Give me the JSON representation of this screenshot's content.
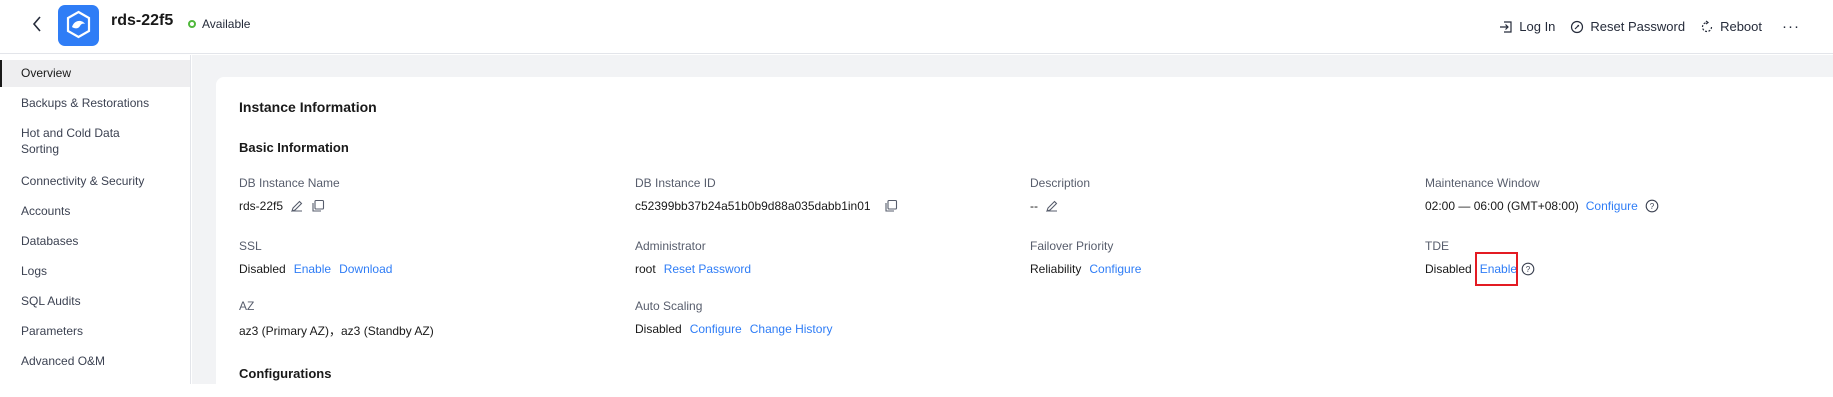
{
  "header": {
    "instance_name": "rds-22f5",
    "status": "Available",
    "actions": {
      "log_in": "Log In",
      "reset_password": "Reset Password",
      "reboot": "Reboot",
      "more": "···"
    }
  },
  "sidebar": {
    "items": [
      {
        "label": "Overview",
        "active": true
      },
      {
        "label": "Backups & Restorations"
      },
      {
        "label": "Hot and Cold Data Sorting"
      },
      {
        "label": "Connectivity & Security"
      },
      {
        "label": "Accounts"
      },
      {
        "label": "Databases"
      },
      {
        "label": "Logs"
      },
      {
        "label": "SQL Audits"
      },
      {
        "label": "Parameters"
      },
      {
        "label": "Advanced O&M"
      }
    ]
  },
  "content": {
    "section_title": "Instance Information",
    "basic_info_title": "Basic Information",
    "configurations_title": "Configurations",
    "fields": {
      "db_instance_name": {
        "label": "DB Instance Name",
        "value": "rds-22f5"
      },
      "db_instance_id": {
        "label": "DB Instance ID",
        "value": "c52399bb37b24a51b0b9d88a035dabb1in01"
      },
      "description": {
        "label": "Description",
        "value": "--"
      },
      "maintenance_window": {
        "label": "Maintenance Window",
        "value": "02:00 — 06:00 (GMT+08:00)",
        "action": "Configure"
      },
      "ssl": {
        "label": "SSL",
        "value": "Disabled",
        "action1": "Enable",
        "action2": "Download"
      },
      "administrator": {
        "label": "Administrator",
        "value": "root",
        "action": "Reset Password"
      },
      "failover_priority": {
        "label": "Failover Priority",
        "value": "Reliability",
        "action": "Configure"
      },
      "tde": {
        "label": "TDE",
        "value": "Disabled",
        "action": "Enable"
      },
      "az": {
        "label": "AZ",
        "value": "az3 (Primary AZ)，az3 (Standby AZ)"
      },
      "auto_scaling": {
        "label": "Auto Scaling",
        "value": "Disabled",
        "action1": "Configure",
        "action2": "Change History"
      }
    }
  },
  "colors": {
    "accent": "#2f7df6",
    "status_ok": "#50b83c",
    "highlight": "#e31b23"
  }
}
